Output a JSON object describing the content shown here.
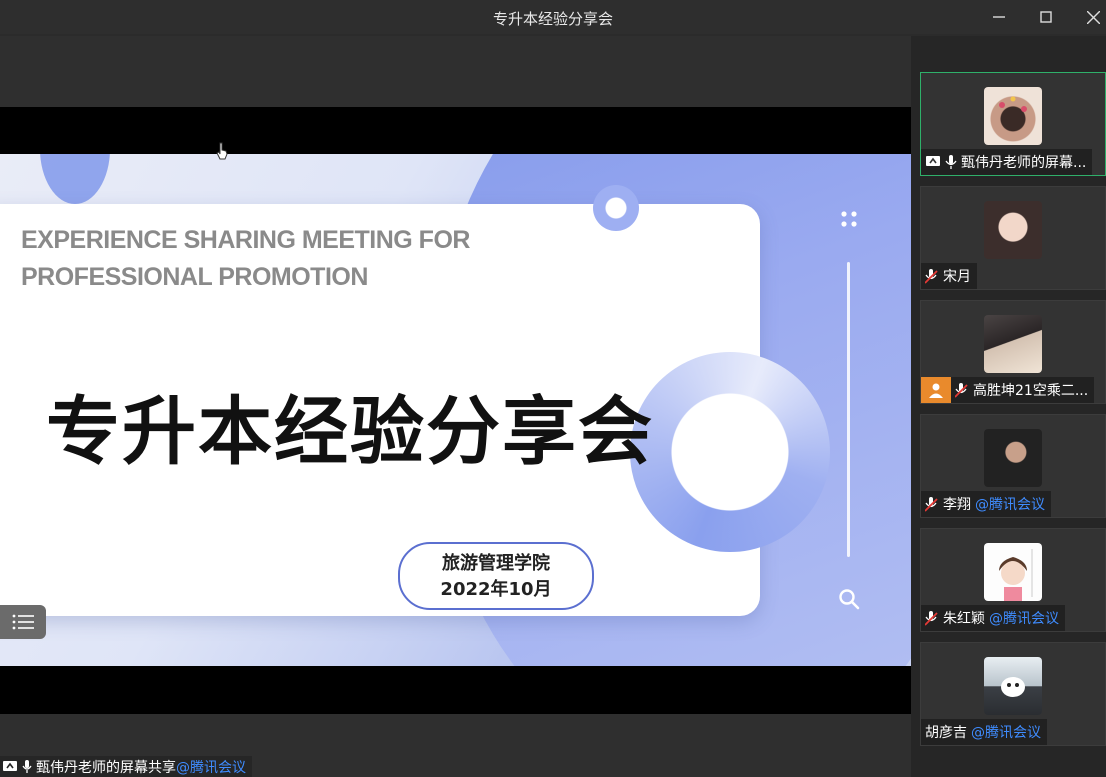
{
  "window": {
    "title": "专升本经验分享会"
  },
  "slide": {
    "english_title_line1": "EXPERIENCE SHARING MEETING FOR",
    "english_title_line2": "PROFESSIONAL PROMOTION",
    "chinese_title": "专升本经验分享会",
    "institution": "旅游管理学院",
    "date": "2022年10月"
  },
  "share_bar": {
    "presenter": "甄伟丹老师的屏幕共享",
    "tag": "@腾讯会议"
  },
  "participants": [
    {
      "name": "甄伟丹老师的屏幕...",
      "tag": "",
      "mic": "on",
      "sharing": true,
      "active": true
    },
    {
      "name": "宋月",
      "tag": "",
      "mic": "muted",
      "sharing": false,
      "active": false
    },
    {
      "name": "高胜坤21空乘二...",
      "tag": "",
      "mic": "muted",
      "sharing": false,
      "active": false,
      "avatar_placeholder": true
    },
    {
      "name": "李翔",
      "tag": "@腾讯会议",
      "mic": "muted",
      "sharing": false,
      "active": false
    },
    {
      "name": "朱红颖",
      "tag": "@腾讯会议",
      "mic": "muted",
      "sharing": false,
      "active": false
    },
    {
      "name": "胡彦吉",
      "tag": "@腾讯会议",
      "mic": "none",
      "sharing": false,
      "active": false
    }
  ],
  "colors": {
    "active_border": "#2fb06a",
    "link_blue": "#3f8cff",
    "slide_accent": "#7f96ea",
    "placeholder_orange": "#e98a2c"
  }
}
